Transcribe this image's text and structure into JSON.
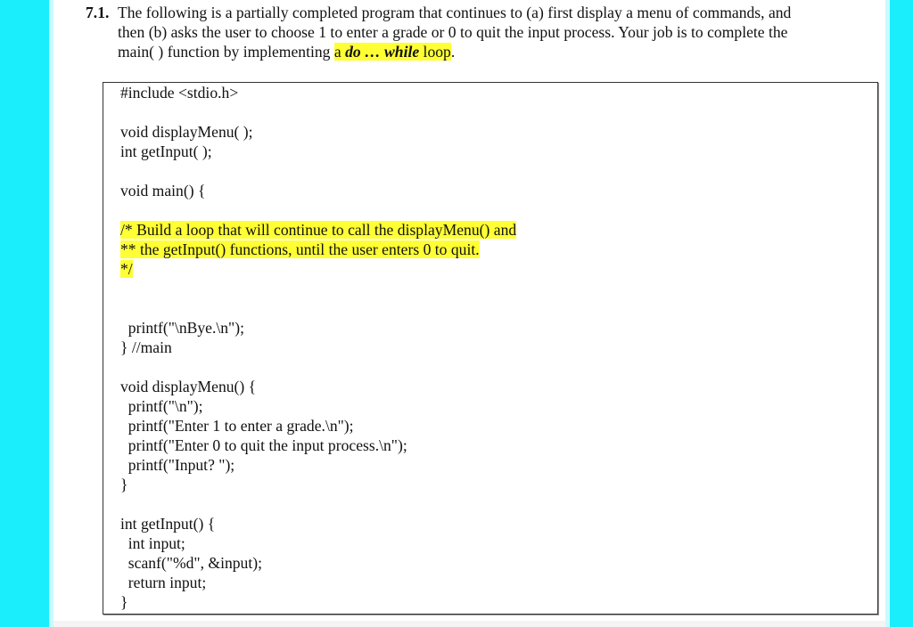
{
  "colors": {
    "side_bar": "#1aeefc",
    "side_bar_edge": "#c8fbff",
    "highlight": "#ffff33"
  },
  "question": {
    "number": "7.1.",
    "text_line1": "The following is a partially completed program that continues to (a) first display a menu of commands, and",
    "text_line2": "then (b) asks the user to choose 1 to enter a grade or 0 to quit the input process. Your job is to complete the",
    "text_line3_prefix": "main( ) function by implementing ",
    "highlight_a": "a ",
    "highlight_do": "do … while",
    "highlight_loop": " loop",
    "text_line3_suffix": "."
  },
  "code": {
    "lines": [
      {
        "text": "#include <stdio.h>",
        "highlight": false
      },
      {
        "text": "",
        "highlight": false
      },
      {
        "text": "void displayMenu( );",
        "highlight": false
      },
      {
        "text": "int getInput( );",
        "highlight": false
      },
      {
        "text": "",
        "highlight": false
      },
      {
        "text": "void main() {",
        "highlight": false
      },
      {
        "text": "",
        "highlight": false
      },
      {
        "text": "/* Build a loop that will continue to call the displayMenu() and",
        "highlight": true
      },
      {
        "text": "** the getInput() functions, until the user enters 0 to quit.",
        "highlight": true
      },
      {
        "text": "*/",
        "highlight": true
      },
      {
        "text": "",
        "highlight": false
      },
      {
        "text": "",
        "highlight": false
      },
      {
        "text": "  printf(\"\\nBye.\\n\");",
        "highlight": false
      },
      {
        "text": "} //main",
        "highlight": false
      },
      {
        "text": "",
        "highlight": false
      },
      {
        "text": "void displayMenu() {",
        "highlight": false
      },
      {
        "text": "  printf(\"\\n\");",
        "highlight": false
      },
      {
        "text": "  printf(\"Enter 1 to enter a grade.\\n\");",
        "highlight": false
      },
      {
        "text": "  printf(\"Enter 0 to quit the input process.\\n\");",
        "highlight": false
      },
      {
        "text": "  printf(\"Input? \");",
        "highlight": false
      },
      {
        "text": "}",
        "highlight": false
      },
      {
        "text": "",
        "highlight": false
      },
      {
        "text": "int getInput() {",
        "highlight": false
      },
      {
        "text": "  int input;",
        "highlight": false
      },
      {
        "text": "  scanf(\"%d\", &input);",
        "highlight": false
      },
      {
        "text": "  return input;",
        "highlight": false
      },
      {
        "text": "}",
        "highlight": false
      }
    ]
  }
}
